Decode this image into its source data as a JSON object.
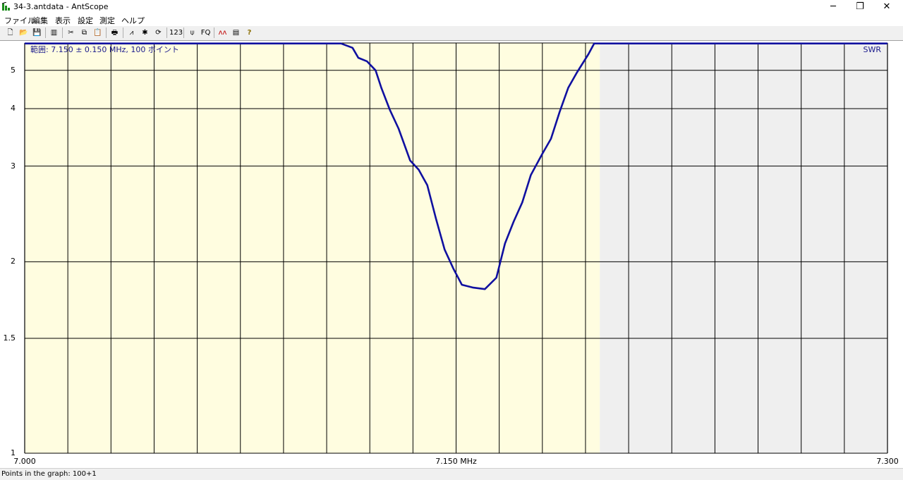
{
  "window": {
    "title": "34-3.antdata - AntScope",
    "minimize": "─",
    "restore": "❐",
    "close": "✕"
  },
  "menu": [
    "ファイル",
    "編集",
    "表示",
    "設定",
    "測定",
    "ヘルプ"
  ],
  "toolbar": [
    {
      "name": "new-icon",
      "glyph": "🗋"
    },
    {
      "name": "open-icon",
      "glyph": "📂"
    },
    {
      "name": "save-icon",
      "glyph": "💾"
    },
    {
      "name": "sep"
    },
    {
      "name": "marker-icon",
      "glyph": "▥"
    },
    {
      "name": "sep"
    },
    {
      "name": "cut-icon",
      "glyph": "✂"
    },
    {
      "name": "copy-icon",
      "glyph": "⧉"
    },
    {
      "name": "paste-icon",
      "glyph": "📋"
    },
    {
      "name": "sep"
    },
    {
      "name": "print-icon",
      "glyph": "🖶"
    },
    {
      "name": "sep"
    },
    {
      "name": "cursor-icon",
      "glyph": "⩘"
    },
    {
      "name": "autoscale-icon",
      "glyph": "✱"
    },
    {
      "name": "refresh-icon",
      "glyph": "⟳"
    },
    {
      "name": "sep"
    },
    {
      "name": "numbers-icon",
      "glyph": "123"
    },
    {
      "name": "sep"
    },
    {
      "name": "antenna-icon",
      "glyph": "⍦"
    },
    {
      "name": "fq-icon",
      "glyph": "FQ"
    },
    {
      "name": "sep"
    },
    {
      "name": "sweep-icon",
      "glyph": "ᴧᴧ"
    },
    {
      "name": "folder-icon",
      "glyph": "▤"
    },
    {
      "name": "help-icon",
      "glyph": "?"
    }
  ],
  "colors": {
    "range_bg": "#fffde0",
    "out_bg": "#efefef",
    "grid": "#000000",
    "curve": "#1010a0",
    "label": "#1a1a8c"
  },
  "graph": {
    "range_label": "範囲: 7.150 ± 0.150 MHz, 100 ポイント",
    "param_label": "SWR"
  },
  "chart_data": {
    "type": "line",
    "x": [
      7.0,
      7.11,
      7.114,
      7.116,
      7.119,
      7.122,
      7.124,
      7.127,
      7.13,
      7.134,
      7.137,
      7.14,
      7.143,
      7.146,
      7.149,
      7.152,
      7.156,
      7.16,
      7.164,
      7.167,
      7.17,
      7.173,
      7.176,
      7.18,
      7.183,
      7.186,
      7.189,
      7.192,
      7.196,
      7.198,
      7.201,
      7.205,
      7.3
    ],
    "y": [
      5.98,
      5.98,
      5.8,
      5.42,
      5.3,
      5.0,
      4.5,
      3.97,
      3.6,
      3.08,
      2.95,
      2.75,
      2.38,
      2.1,
      1.95,
      1.83,
      1.81,
      1.8,
      1.88,
      2.15,
      2.35,
      2.55,
      2.88,
      3.18,
      3.42,
      3.93,
      4.5,
      4.93,
      5.55,
      5.98,
      5.98,
      5.98,
      5.98
    ],
    "xlim": [
      7.0,
      7.3
    ],
    "ylim": [
      1,
      6
    ],
    "y_scale": "swr",
    "xticks": [
      "7.000",
      "7.150 MHz",
      "7.300"
    ],
    "yticks": [
      "1",
      "1.5",
      "2",
      "3",
      "4",
      "5"
    ],
    "highlight_range": [
      7.0,
      7.2
    ],
    "grid": true
  },
  "status": {
    "text": "Points in the graph: 100+1"
  }
}
